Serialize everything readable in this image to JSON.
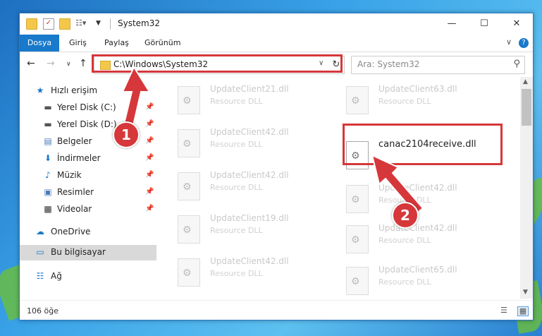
{
  "window": {
    "title": "System32"
  },
  "ribbon": {
    "file": "Dosya",
    "tabs": [
      "Giriş",
      "Paylaş",
      "Görünüm"
    ],
    "help": "?"
  },
  "navigation": {
    "address": "C:\\Windows\\System32",
    "search_placeholder": "Ara: System32"
  },
  "sidebar": {
    "quick_access": "Hızlı erişim",
    "items": [
      "Yerel Disk (C:)",
      "Yerel Disk (D:)",
      "Belgeler",
      "İndirmeler",
      "Müzik",
      "Resimler",
      "Videolar"
    ],
    "onedrive": "OneDrive",
    "this_pc": "Bu bilgisayar",
    "network": "Ağ"
  },
  "files": {
    "left": [
      {
        "name": "UpdateClient21.dll",
        "desc": "Resource DLL"
      },
      {
        "name": "UpdateClient42.dll",
        "desc": "Resource DLL"
      },
      {
        "name": "UpdateClient42.dll",
        "desc": "Resource DLL"
      },
      {
        "name": "UpdateClient19.dll",
        "desc": "Resource DLL"
      },
      {
        "name": "UpdateClient42.dll",
        "desc": "Resource DLL"
      }
    ],
    "right": [
      {
        "name": "UpdateClient63.dll",
        "desc": "Resource DLL"
      },
      {
        "name": "canac2104receive.dll",
        "desc": ""
      },
      {
        "name": "UpdateClient42.dll",
        "desc": "Resource DLL"
      },
      {
        "name": "UpdateClient42.dll",
        "desc": "Resource DLL"
      },
      {
        "name": "UpdateClient65.dll",
        "desc": "Resource DLL"
      }
    ]
  },
  "status": {
    "count": "106 öğe"
  },
  "annotations": {
    "step1": "1",
    "step2": "2"
  },
  "colors": {
    "accent": "#1979ca",
    "highlight": "#d6373a"
  }
}
